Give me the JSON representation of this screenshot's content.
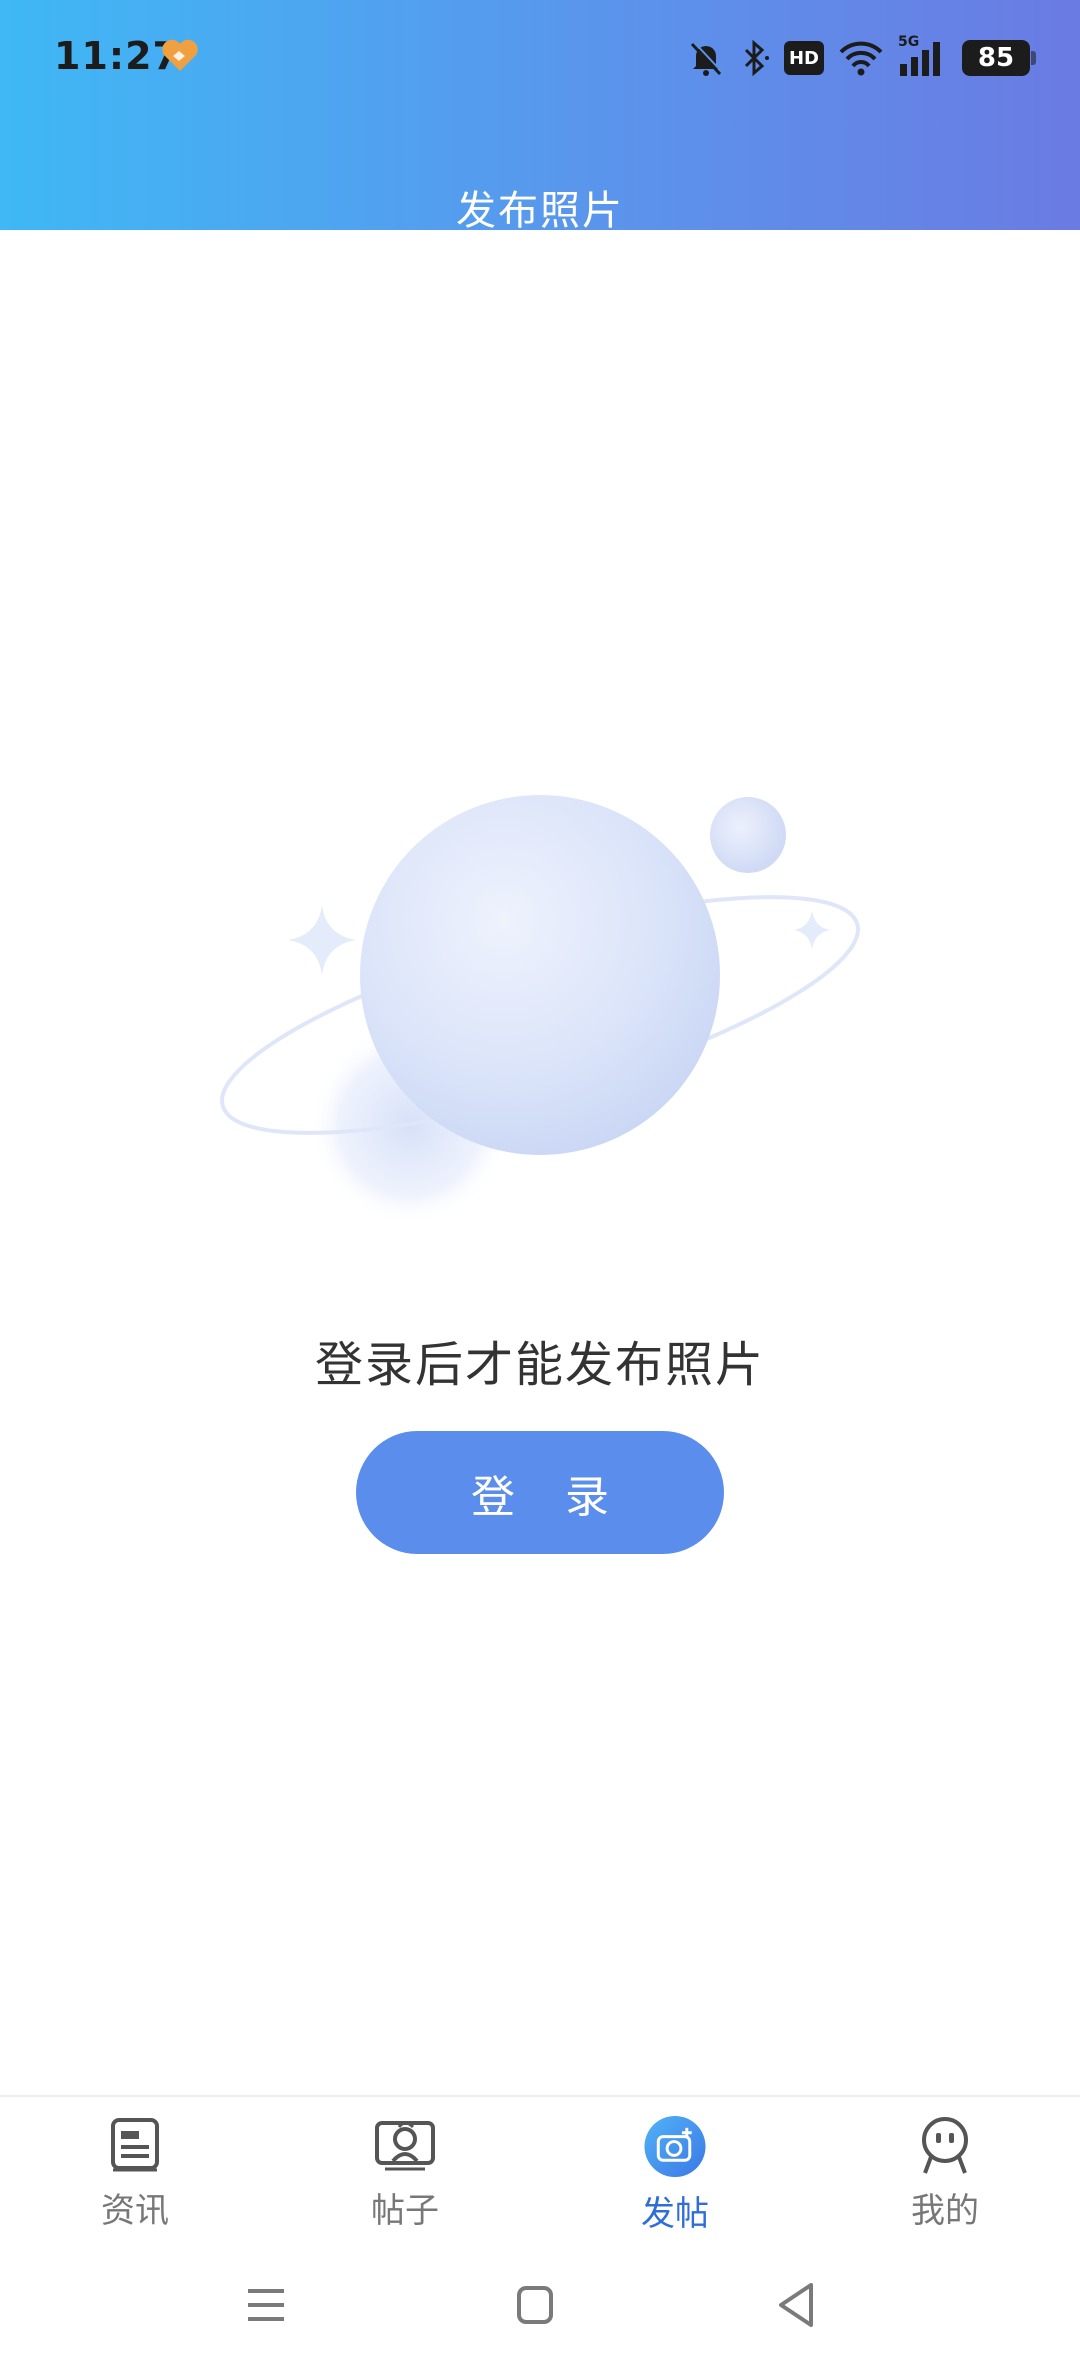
{
  "status_bar": {
    "time": "11:27",
    "signal_label": "5G",
    "hd_label": "HD",
    "battery": "85",
    "icons": [
      "app-notification-icon",
      "bell-muted-icon",
      "bluetooth-icon",
      "hd-icon",
      "wifi-icon",
      "signal-icon",
      "battery-icon"
    ]
  },
  "header": {
    "title": "发布照片",
    "gradient": [
      "#3fb8f5",
      "#6a7be3"
    ]
  },
  "empty_state": {
    "illustration": "planet-illustration",
    "message": "登录后才能发布照片",
    "login_button": "登 录",
    "accent": "#5b8ded"
  },
  "tabbar": {
    "active_color": "#2f6ed8",
    "tabs": [
      {
        "label": "资讯",
        "icon": "news-icon",
        "active": false
      },
      {
        "label": "帖子",
        "icon": "posts-icon",
        "active": false
      },
      {
        "label": "发帖",
        "icon": "camera-post-icon",
        "active": true
      },
      {
        "label": "我的",
        "icon": "profile-icon",
        "active": false
      }
    ]
  },
  "navbar": {
    "buttons": [
      "menu-icon",
      "home-icon",
      "back-icon"
    ]
  }
}
